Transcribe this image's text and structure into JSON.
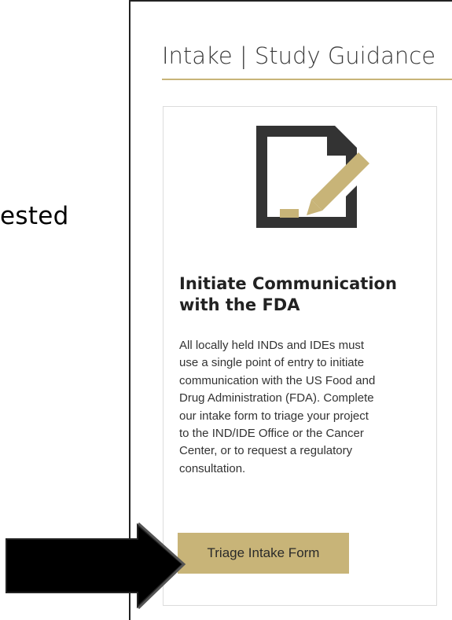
{
  "background_text": "ested",
  "panel": {
    "title": "Intake | Study Guidance",
    "accent_color": "#c8b478"
  },
  "card": {
    "icon": "document-edit-icon",
    "heading_line1": "Initiate Communication",
    "heading_line2": "with the FDA",
    "body_lines": [
      "All locally held INDs and IDEs must",
      "use a single point of entry to initiate",
      "communication with the US Food and",
      "Drug Administration (FDA). Complete",
      "our intake form to triage your project",
      "to the IND/IDE Office or the Cancer",
      "Center, or to request a regulatory",
      "consultation."
    ],
    "button_label": "Triage Intake Form"
  },
  "annotation": {
    "icon": "pointing-arrow-icon"
  }
}
